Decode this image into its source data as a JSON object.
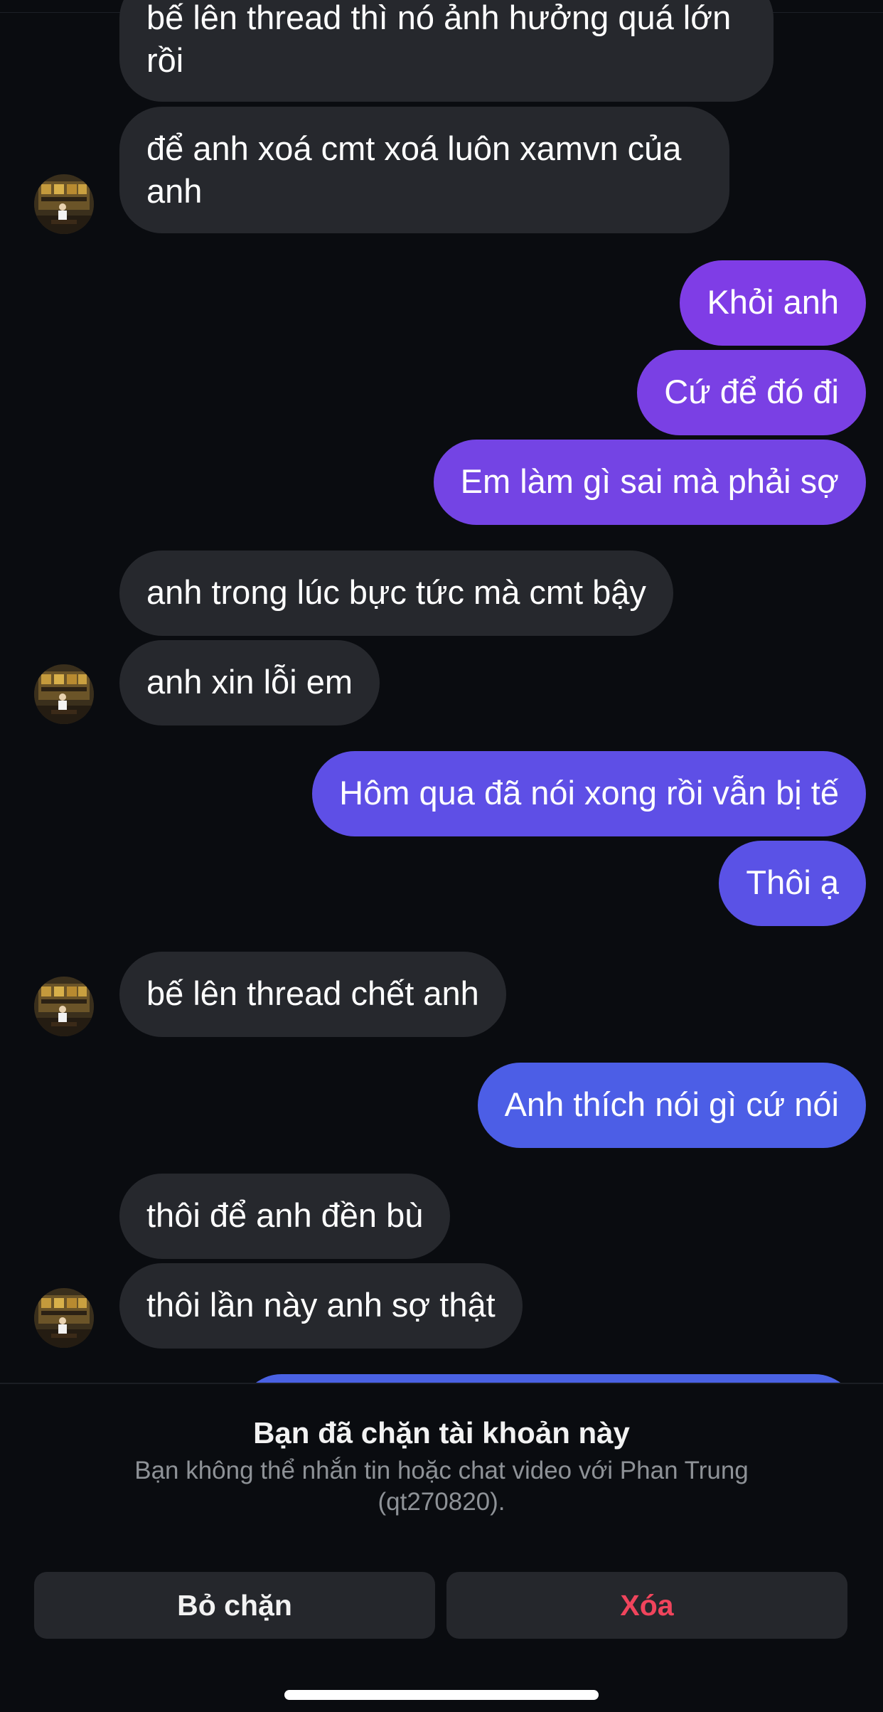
{
  "messages": {
    "m1": "bế lên thread thì nó ảnh hưởng quá lớn rồi",
    "m2": "để anh xoá cmt xoá luôn xamvn của anh",
    "m3": "Khỏi anh",
    "m4": "Cứ để đó đi",
    "m5": "Em làm gì sai mà phải sợ",
    "m6": "anh trong lúc bực tức mà cmt bậy",
    "m7": "anh xin lỗi em",
    "m8": "Hôm qua đã nói xong rồi vẫn bị tế",
    "m9": "Thôi ạ",
    "m10": "bế lên thread chết anh",
    "m11": "Anh thích nói gì cứ nói",
    "m12": "thôi để anh đền bù",
    "m13": "thôi lần này anh sợ thật"
  },
  "blocked": {
    "title": "Bạn đã chặn tài khoản này",
    "description": "Bạn không thể nhắn tin hoặc chat video với Phan Trung (qt270820).",
    "unblock_label": "Bỏ chặn",
    "delete_label": "Xóa"
  },
  "colors": {
    "incoming_bubble": "#26282d",
    "outgoing_purple": "#7b3fe4",
    "outgoing_blue": "#4b5ee6",
    "delete_red": "#f0445c"
  },
  "icons": {
    "avatar": "contact-avatar-photo"
  }
}
